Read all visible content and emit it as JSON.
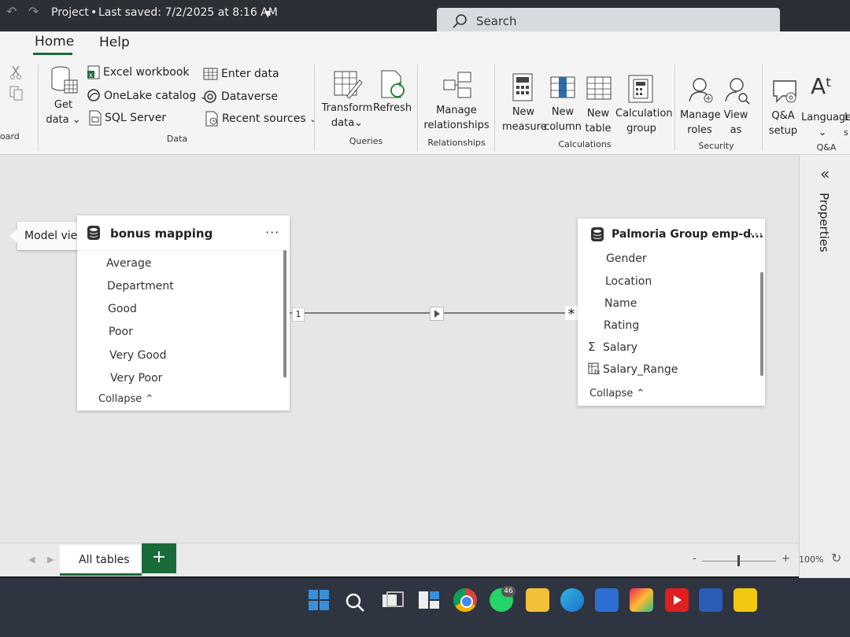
{
  "titlebar": {
    "title": "Project",
    "saved": "Last saved: 7/2/2025 at 8:16 AM",
    "search_placeholder": "Search"
  },
  "tabs": {
    "home": "Home",
    "help": "Help"
  },
  "ribbon": {
    "clipboard_group": "oard",
    "get_data": [
      "Get",
      "data"
    ],
    "excel": "Excel workbook",
    "onelake": "OneLake catalog",
    "sql": "SQL Server",
    "enter_data": "Enter data",
    "dataverse": "Dataverse",
    "recent": "Recent sources",
    "data_group": "Data",
    "transform": [
      "Transform",
      "data"
    ],
    "refresh": "Refresh",
    "queries_group": "Queries",
    "manage_rel": [
      "Manage",
      "relationships"
    ],
    "relationships_group": "Relationships",
    "new_measure": [
      "New",
      "measure"
    ],
    "new_column": [
      "New",
      "column"
    ],
    "new_table": [
      "New",
      "table"
    ],
    "calc_group": [
      "Calculation",
      "group"
    ],
    "calculations_group": "Calculations",
    "manage_roles": [
      "Manage",
      "roles"
    ],
    "view_as": [
      "View",
      "as"
    ],
    "security_group": "Security",
    "qa_setup": [
      "Q&A",
      "setup"
    ],
    "language": "Language",
    "language_tail": "L",
    "s_tail": "s",
    "qa_group": "Q&A"
  },
  "tooltip": "Model view",
  "bonus_table": {
    "title": "bonus mapping",
    "fields": [
      "Average",
      "Department",
      "Good",
      "Poor",
      "Very Good",
      "Very Poor"
    ],
    "collapse": "Collapse"
  },
  "emp_table": {
    "title": "Palmoria Group emp-d...",
    "fields": [
      "Gender",
      "Location",
      "Name",
      "Rating",
      "Salary",
      "Salary_Range"
    ],
    "collapse": "Collapse"
  },
  "relationship": {
    "left_cardinality": "1",
    "right_cardinality": "*"
  },
  "properties_pane": {
    "label": "Properties",
    "collapse_icon": "«"
  },
  "bottom": {
    "all_tables": "All tables",
    "add": "+",
    "zoom": "100%",
    "zoom_minus": "-",
    "zoom_plus": "+"
  },
  "taskbar": {
    "whatsapp_badge": "46"
  }
}
